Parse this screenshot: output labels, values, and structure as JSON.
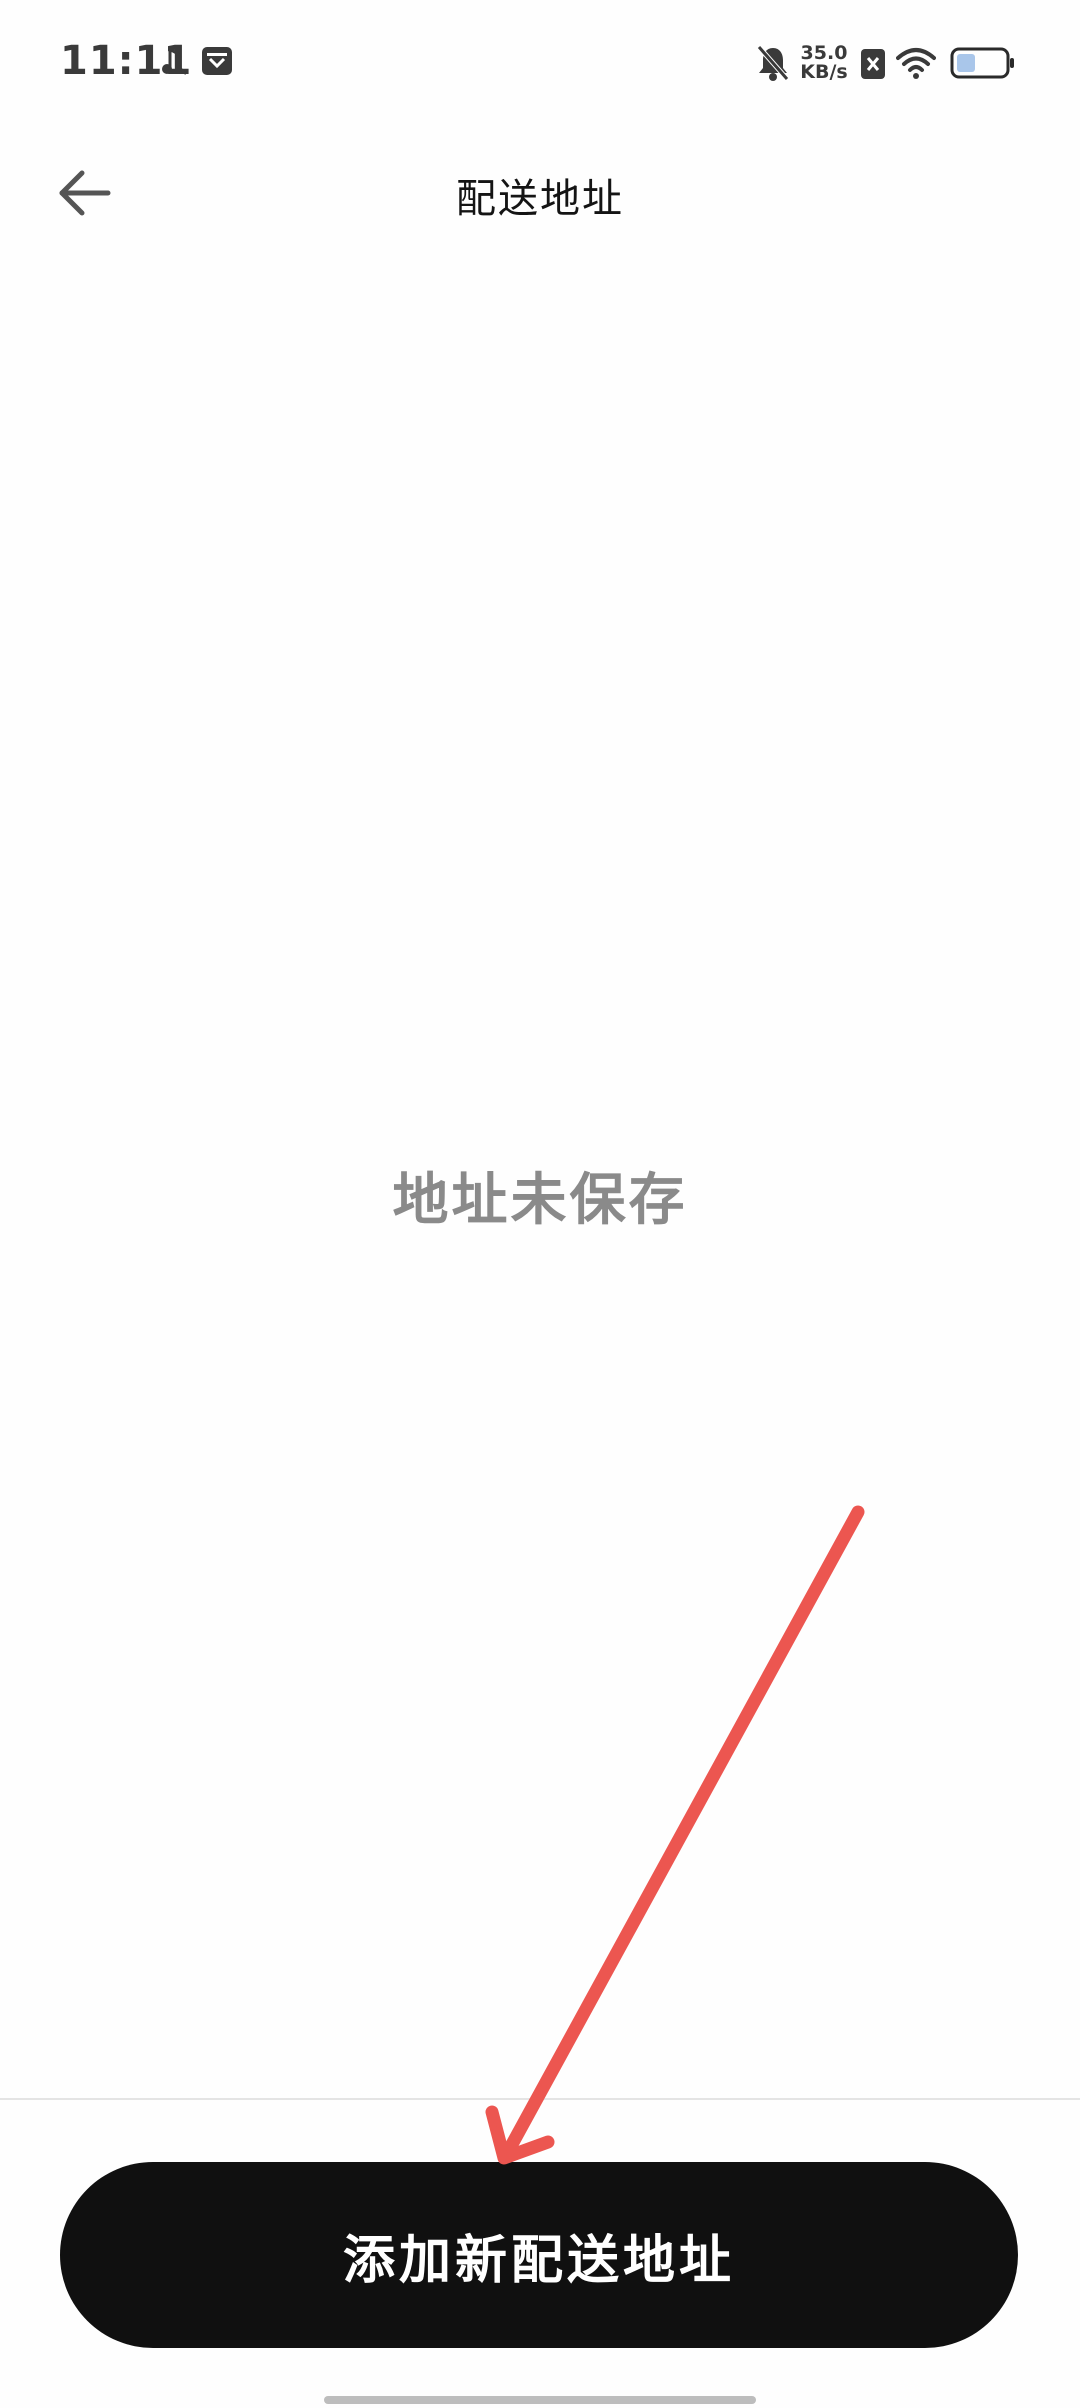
{
  "status_bar": {
    "time": "11:11",
    "net_speed_value": "35.0",
    "net_speed_unit": "KB/s",
    "battery_level": 0.35
  },
  "app_bar": {
    "title": "配送地址"
  },
  "empty_state": {
    "message": "地址未保存"
  },
  "actions": {
    "add_address_label": "添加新配送地址"
  },
  "colors": {
    "button_background": "#101010",
    "annotation_arrow": "#ec5650",
    "empty_text": "#8a8a8a"
  }
}
